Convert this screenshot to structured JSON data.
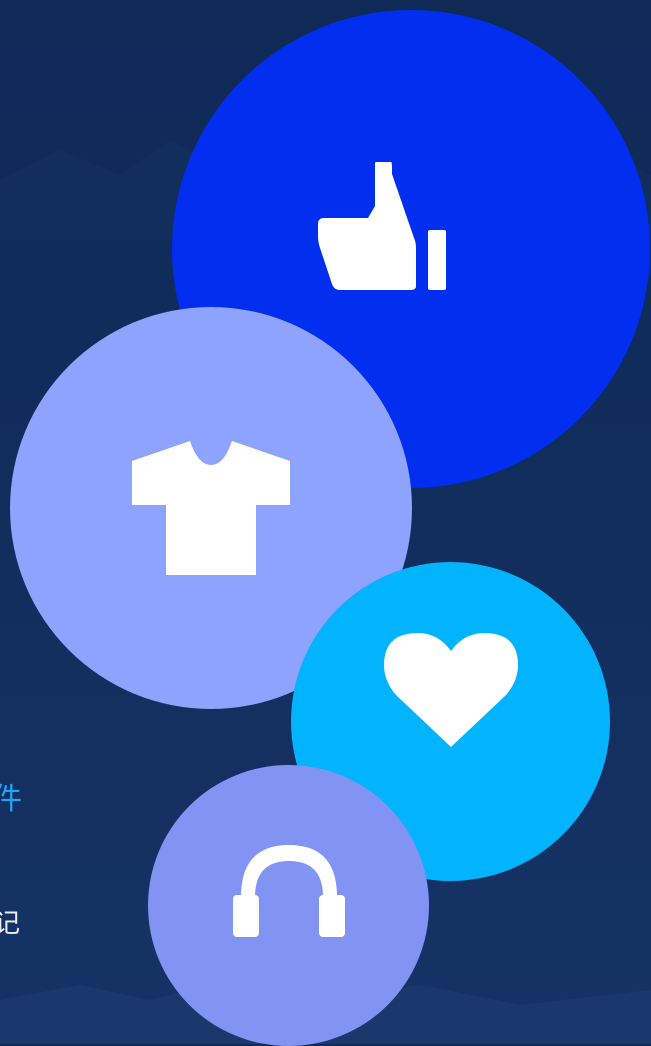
{
  "colors": {
    "background": "#112d5c",
    "like_bubble": "#022ef0",
    "shirt_bubble": "#8ea3fe",
    "heart_bubble": "#02b3fe",
    "headphones_bubble": "#8194f4",
    "icon": "#ffffff",
    "text_accent": "#1ba8f5",
    "text_light": "#e9eef9"
  },
  "bubbles": [
    {
      "id": "like",
      "icon": "thumbs-up-icon"
    },
    {
      "id": "shirt",
      "icon": "tshirt-icon"
    },
    {
      "id": "heart",
      "icon": "heart-icon"
    },
    {
      "id": "headphones",
      "icon": "headphones-icon"
    }
  ],
  "side_text": {
    "top": "件",
    "bottom": "记"
  }
}
